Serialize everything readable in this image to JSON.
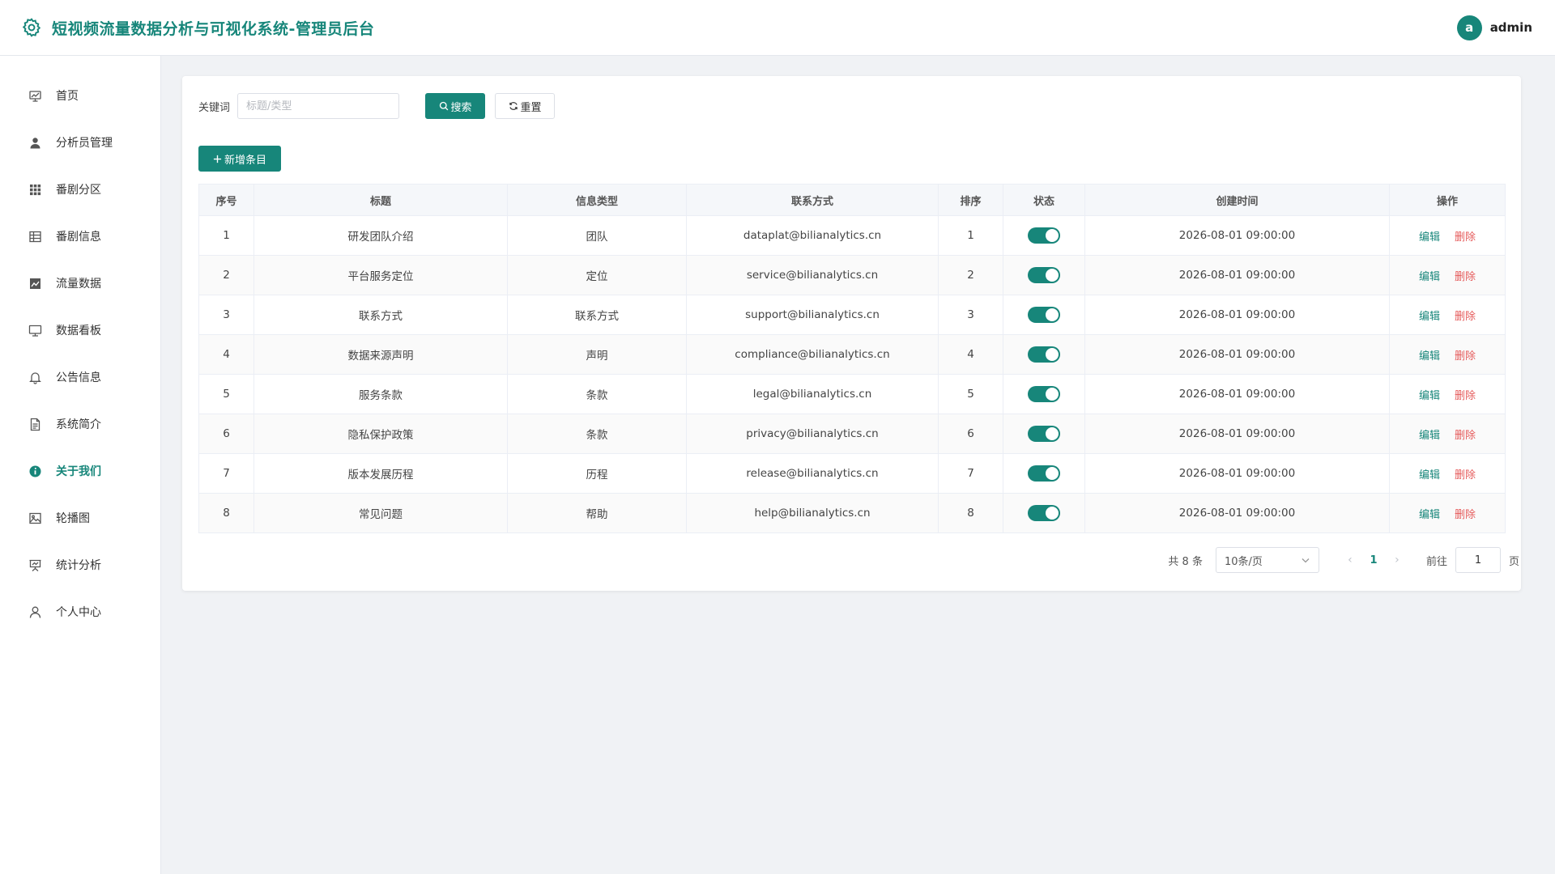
{
  "header": {
    "title": "短视频流量数据分析与可视化系统-管理员后台",
    "avatar_letter": "a",
    "username": "admin"
  },
  "sidebar": {
    "items": [
      {
        "label": "首页",
        "icon": "dashboard-icon"
      },
      {
        "label": "分析员管理",
        "icon": "user-icon"
      },
      {
        "label": "番剧分区",
        "icon": "grid-icon"
      },
      {
        "label": "番剧信息",
        "icon": "table-icon"
      },
      {
        "label": "流量数据",
        "icon": "chart-icon"
      },
      {
        "label": "数据看板",
        "icon": "monitor-icon"
      },
      {
        "label": "公告信息",
        "icon": "bell-icon"
      },
      {
        "label": "系统简介",
        "icon": "document-icon"
      },
      {
        "label": "关于我们",
        "icon": "info-icon"
      },
      {
        "label": "轮播图",
        "icon": "picture-icon"
      },
      {
        "label": "统计分析",
        "icon": "presentation-icon"
      },
      {
        "label": "个人中心",
        "icon": "person-icon"
      }
    ],
    "active_index": 8
  },
  "search": {
    "label": "关键词",
    "placeholder": "标题/类型",
    "value": "",
    "search_label": "搜索",
    "reset_label": "重置"
  },
  "toolbar": {
    "add_label": "新增条目"
  },
  "table": {
    "columns": [
      "序号",
      "标题",
      "信息类型",
      "联系方式",
      "排序",
      "状态",
      "创建时间",
      "操作"
    ],
    "rows": [
      {
        "no": "1",
        "title": "研发团队介绍",
        "type": "团队",
        "contact": "dataplat@bilianalytics.cn",
        "order": "1",
        "status": true,
        "created": "2026-08-01 09:00:00"
      },
      {
        "no": "2",
        "title": "平台服务定位",
        "type": "定位",
        "contact": "service@bilianalytics.cn",
        "order": "2",
        "status": true,
        "created": "2026-08-01 09:00:00"
      },
      {
        "no": "3",
        "title": "联系方式",
        "type": "联系方式",
        "contact": "support@bilianalytics.cn",
        "order": "3",
        "status": true,
        "created": "2026-08-01 09:00:00"
      },
      {
        "no": "4",
        "title": "数据来源声明",
        "type": "声明",
        "contact": "compliance@bilianalytics.cn",
        "order": "4",
        "status": true,
        "created": "2026-08-01 09:00:00"
      },
      {
        "no": "5",
        "title": "服务条款",
        "type": "条款",
        "contact": "legal@bilianalytics.cn",
        "order": "5",
        "status": true,
        "created": "2026-08-01 09:00:00"
      },
      {
        "no": "6",
        "title": "隐私保护政策",
        "type": "条款",
        "contact": "privacy@bilianalytics.cn",
        "order": "6",
        "status": true,
        "created": "2026-08-01 09:00:00"
      },
      {
        "no": "7",
        "title": "版本发展历程",
        "type": "历程",
        "contact": "release@bilianalytics.cn",
        "order": "7",
        "status": true,
        "created": "2026-08-01 09:00:00"
      },
      {
        "no": "8",
        "title": "常见问题",
        "type": "帮助",
        "contact": "help@bilianalytics.cn",
        "order": "8",
        "status": true,
        "created": "2026-08-01 09:00:00"
      }
    ],
    "edit_label": "编辑",
    "delete_label": "删除"
  },
  "pagination": {
    "total_text": "共 8 条",
    "page_size": "10条/页",
    "current_page": "1",
    "goto_label": "前往",
    "goto_value": "1",
    "page_suffix": "页"
  },
  "colors": {
    "accent": "#17867a",
    "danger": "#e55a5a"
  }
}
